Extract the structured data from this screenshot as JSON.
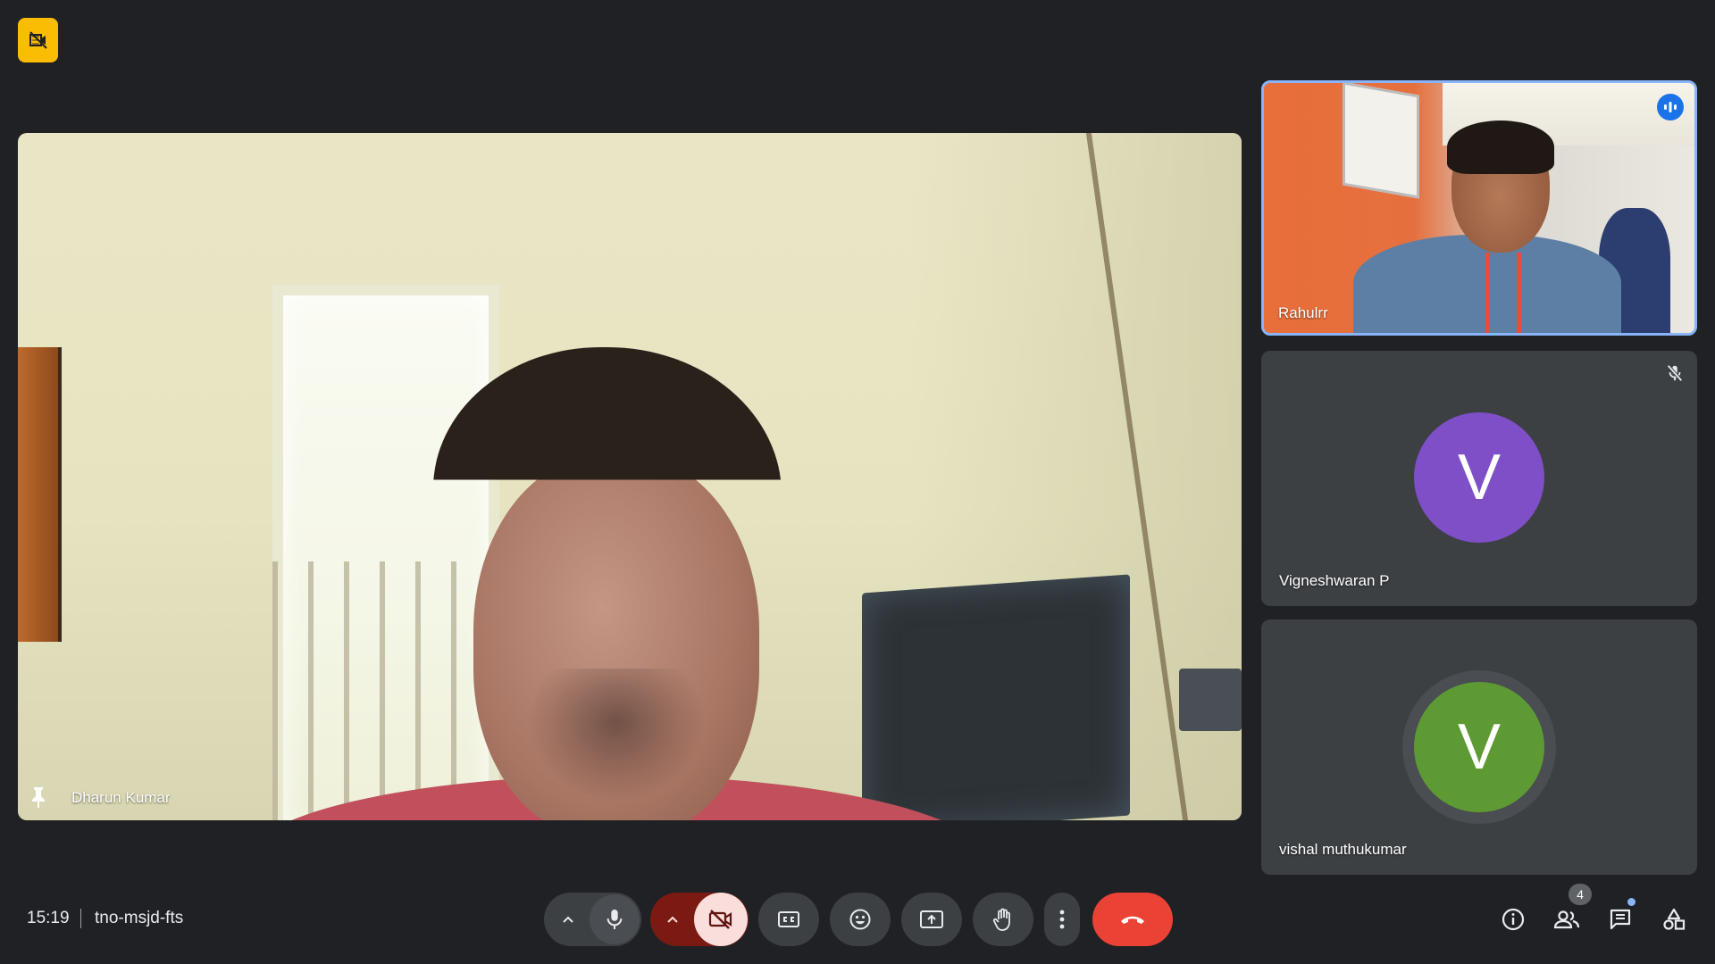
{
  "top": {
    "badge_icon": "camera-off-icon",
    "badge_color": "#fbbc04"
  },
  "main_tile": {
    "participant_name": "Dharun Kumar",
    "pin_icon": "pin-icon"
  },
  "side_tiles": [
    {
      "participant_name": "Rahulrr",
      "status_icon": "speaking-icon",
      "border_color": "#8ab4f8"
    },
    {
      "participant_name": "Vigneshwaran P",
      "avatar_letter": "V",
      "avatar_color": "#7e4fc6",
      "status_icon": "mic-off-icon"
    },
    {
      "participant_name": "vishal muthukumar",
      "avatar_letter": "V",
      "avatar_color": "#5e9a34"
    }
  ],
  "bottom_bar": {
    "time": "15:19",
    "meeting_code": "tno-msjd-fts",
    "controls": {
      "mic": "microphone-icon",
      "camera": "camera-off-icon",
      "captions": "captions-icon",
      "reactions": "emoji-icon",
      "present": "present-screen-icon",
      "raise_hand": "raise-hand-icon",
      "more": "more-vert-icon",
      "leave": "end-call-icon"
    },
    "end_call_color": "#ea4335",
    "people_count": "4"
  }
}
